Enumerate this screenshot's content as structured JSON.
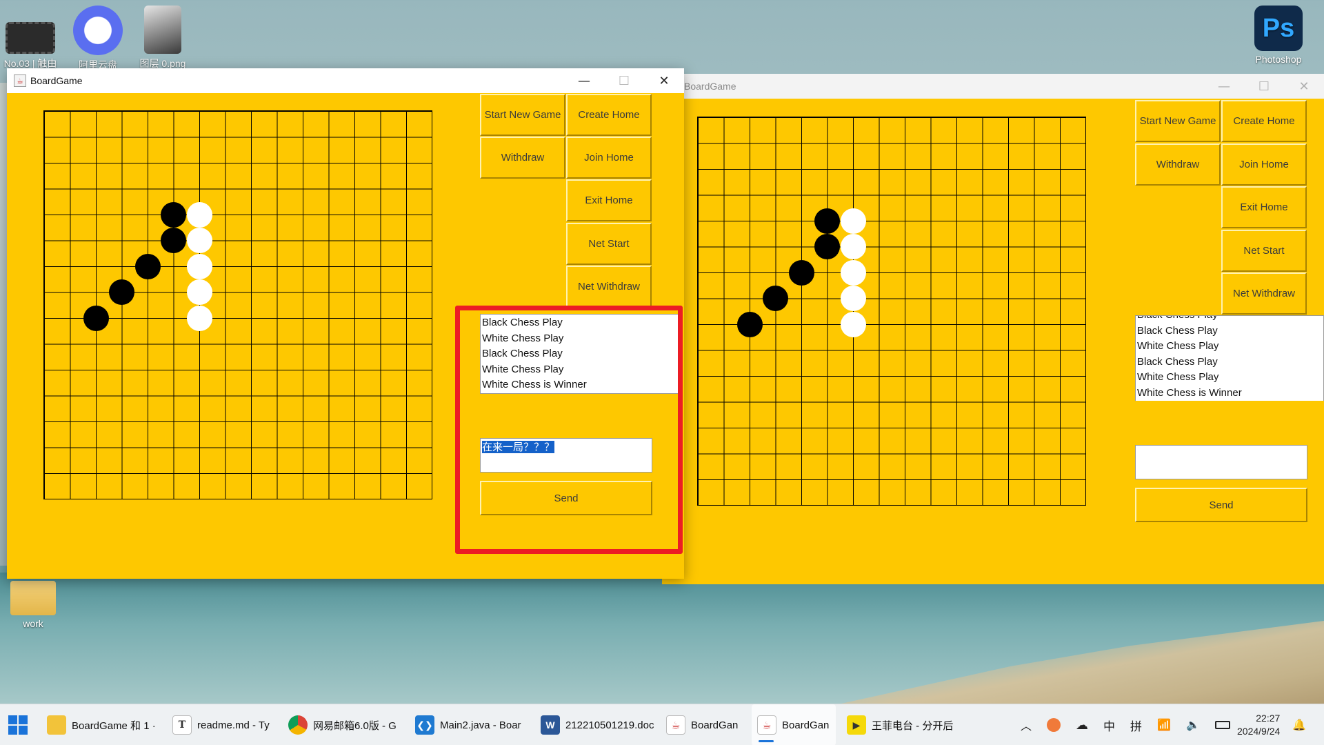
{
  "desktop": {
    "icons": [
      {
        "label": "No.03 | 触由",
        "color": "#2b2b2b"
      },
      {
        "label": "阿里云盘",
        "color": "#5a6ef0"
      },
      {
        "label": "图层 0.png",
        "color": "#6c6c6c"
      },
      {
        "label": "Photoshop",
        "color": "#0f2a4a"
      },
      {
        "label": "work",
        "color": "#e9c66a"
      }
    ]
  },
  "window_main": {
    "title": "BoardGame",
    "controls": {
      "minimize": "—",
      "maximize": "☐",
      "close": "✕"
    },
    "buttons": {
      "start_new_game": "Start New Game",
      "create_home": "Create Home",
      "withdraw": "Withdraw",
      "join_home": "Join Home",
      "exit_home": "Exit Home",
      "net_start": "Net Start",
      "net_withdraw": "Net Withdraw",
      "send": "Send"
    },
    "log_lines": [
      "Black Chess Play",
      "White Chess Play",
      "Black Chess Play",
      "White Chess Play",
      "White Chess is Winner"
    ],
    "message_input": "在来一局？？？"
  },
  "window_second": {
    "title": "BoardGame",
    "controls": {
      "minimize": "—",
      "maximize": "☐",
      "close": "✕"
    },
    "buttons": {
      "start_new_game": "Start New Game",
      "create_home": "Create Home",
      "withdraw": "Withdraw",
      "join_home": "Join Home",
      "exit_home": "Exit Home",
      "net_start": "Net Start",
      "net_withdraw": "Net Withdraw",
      "send": "Send"
    },
    "log_lines": [
      "Black Chess Play",
      "Black Chess Play",
      "White Chess Play",
      "Black Chess Play",
      "White Chess Play",
      "White Chess is Winner"
    ],
    "message_input": ""
  },
  "game": {
    "grid_size": "15x15",
    "black_stones": [
      [
        5,
        4
      ],
      [
        5,
        5
      ],
      [
        4,
        6
      ],
      [
        3,
        7
      ],
      [
        2,
        8
      ]
    ],
    "white_stones": [
      [
        6,
        4
      ],
      [
        6,
        5
      ],
      [
        6,
        6
      ],
      [
        6,
        7
      ],
      [
        6,
        8
      ]
    ]
  },
  "taskbar": {
    "items": [
      {
        "label": "BoardGame 和 1 ·",
        "icon": "folder-icon",
        "color": "#f2c33a"
      },
      {
        "label": "readme.md - Ty",
        "icon": "typora-icon",
        "color": "#ffffff"
      },
      {
        "label": "网易邮箱6.0版 - G",
        "icon": "chrome-icon",
        "color": "#db4437"
      },
      {
        "label": "Main2.java - Boar",
        "icon": "vscode-icon",
        "color": "#1f7ad1"
      },
      {
        "label": "212210501219.doc",
        "icon": "word-icon",
        "color": "#2b5797"
      },
      {
        "label": "BoardGan",
        "icon": "java-icon",
        "color": "#ffffff"
      },
      {
        "label": "BoardGan",
        "icon": "java-icon",
        "color": "#ffffff"
      },
      {
        "label": "王菲电台 - 分开后",
        "icon": "player-icon",
        "color": "#f5d90a"
      }
    ],
    "tray": {
      "ime_lang": "中",
      "ime_mode": "拼",
      "time": "22:27",
      "date": "2024/9/24"
    }
  }
}
